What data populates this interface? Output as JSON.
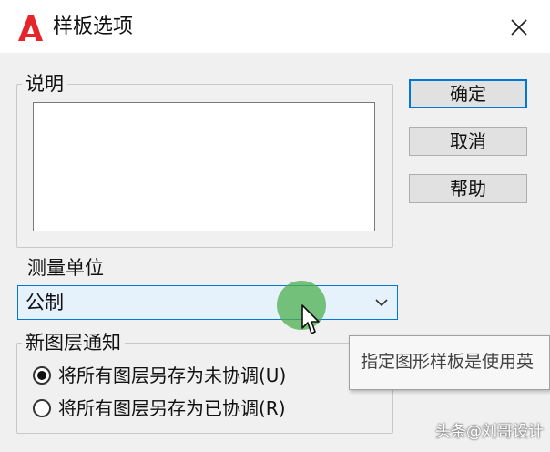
{
  "window": {
    "title": "样板选项",
    "app_icon": "autocad-logo-icon",
    "close_icon": "close-icon",
    "accent_color": "#0078d7",
    "logo_color": "#e5252a"
  },
  "description_group": {
    "label": "说明",
    "text": ""
  },
  "buttons": {
    "ok": "确定",
    "cancel": "取消",
    "help": "帮助"
  },
  "units": {
    "label": "测量单位",
    "selected": "公制",
    "dropdown_icon": "chevron-down-icon"
  },
  "layer_group": {
    "label": "新图层通知",
    "options": [
      {
        "label": "将所有图层另存为未协调(U)",
        "checked": true
      },
      {
        "label": "将所有图层另存为已协调(R)",
        "checked": false
      }
    ]
  },
  "tooltip": {
    "text": "指定图形样板是使用英"
  },
  "watermark": "头条@刘哥设计"
}
